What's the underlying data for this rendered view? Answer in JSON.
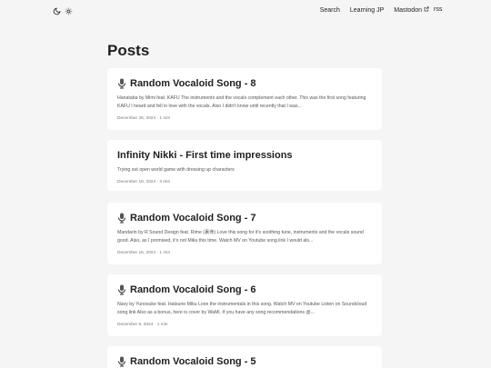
{
  "header": {
    "nav": [
      {
        "label": "Search"
      },
      {
        "label": "Learning JP"
      },
      {
        "label": "Mastodon",
        "external": true
      }
    ],
    "rss_label": "rss",
    "icons": {
      "theme_dark": "moon-icon",
      "theme_light": "sun-icon",
      "external": "external-link-icon"
    }
  },
  "main": {
    "title": "Posts",
    "posts": [
      {
        "icon": "microphone-icon",
        "title": "Random Vocaloid Song - 8",
        "summary": "Hanataba by Mimi feat. KAFU The instruments and the vocals complement each other. This was the first song featuring KAFU I heard and fell in love with the vocals. Also I didn't know until recently that I was...",
        "date": "December 26, 2024",
        "read_time": "1 min"
      },
      {
        "icon": "",
        "title": "Infinity Nikki - First time impressions",
        "summary": "Trying out open world game with dressing up characters",
        "date": "December 16, 2024",
        "read_time": "3 min"
      },
      {
        "icon": "microphone-icon",
        "title": "Random Vocaloid Song - 7",
        "summary": "Mandarin by R Sound Design feat. Rime (裏命) Love this song for it's soothing tune, instruments and the vocals sound good. Also, as I promised, it's not Miku this time. Watch MV on Youtube song.link I would als...",
        "date": "December 16, 2024",
        "read_time": "1 min"
      },
      {
        "icon": "microphone-icon",
        "title": "Random Vocaloid Song - 6",
        "summary": "Navy by Yunosuke feat. Hatsune Miku Love the instrumentals in this song. Watch MV on Youtube Listen on Soundcloud song.link Also as a bonus, here is cover by WaMi. If you have any song recommendations @...",
        "date": "December 6, 2024",
        "read_time": "1 min"
      },
      {
        "icon": "microphone-icon",
        "title": "Random Vocaloid Song - 5",
        "summary": "",
        "date": "",
        "read_time": ""
      }
    ]
  },
  "colors": {
    "background": "#f5f5f5",
    "card": "#ffffff",
    "text": "#1f1f1f",
    "muted": "#777777"
  }
}
